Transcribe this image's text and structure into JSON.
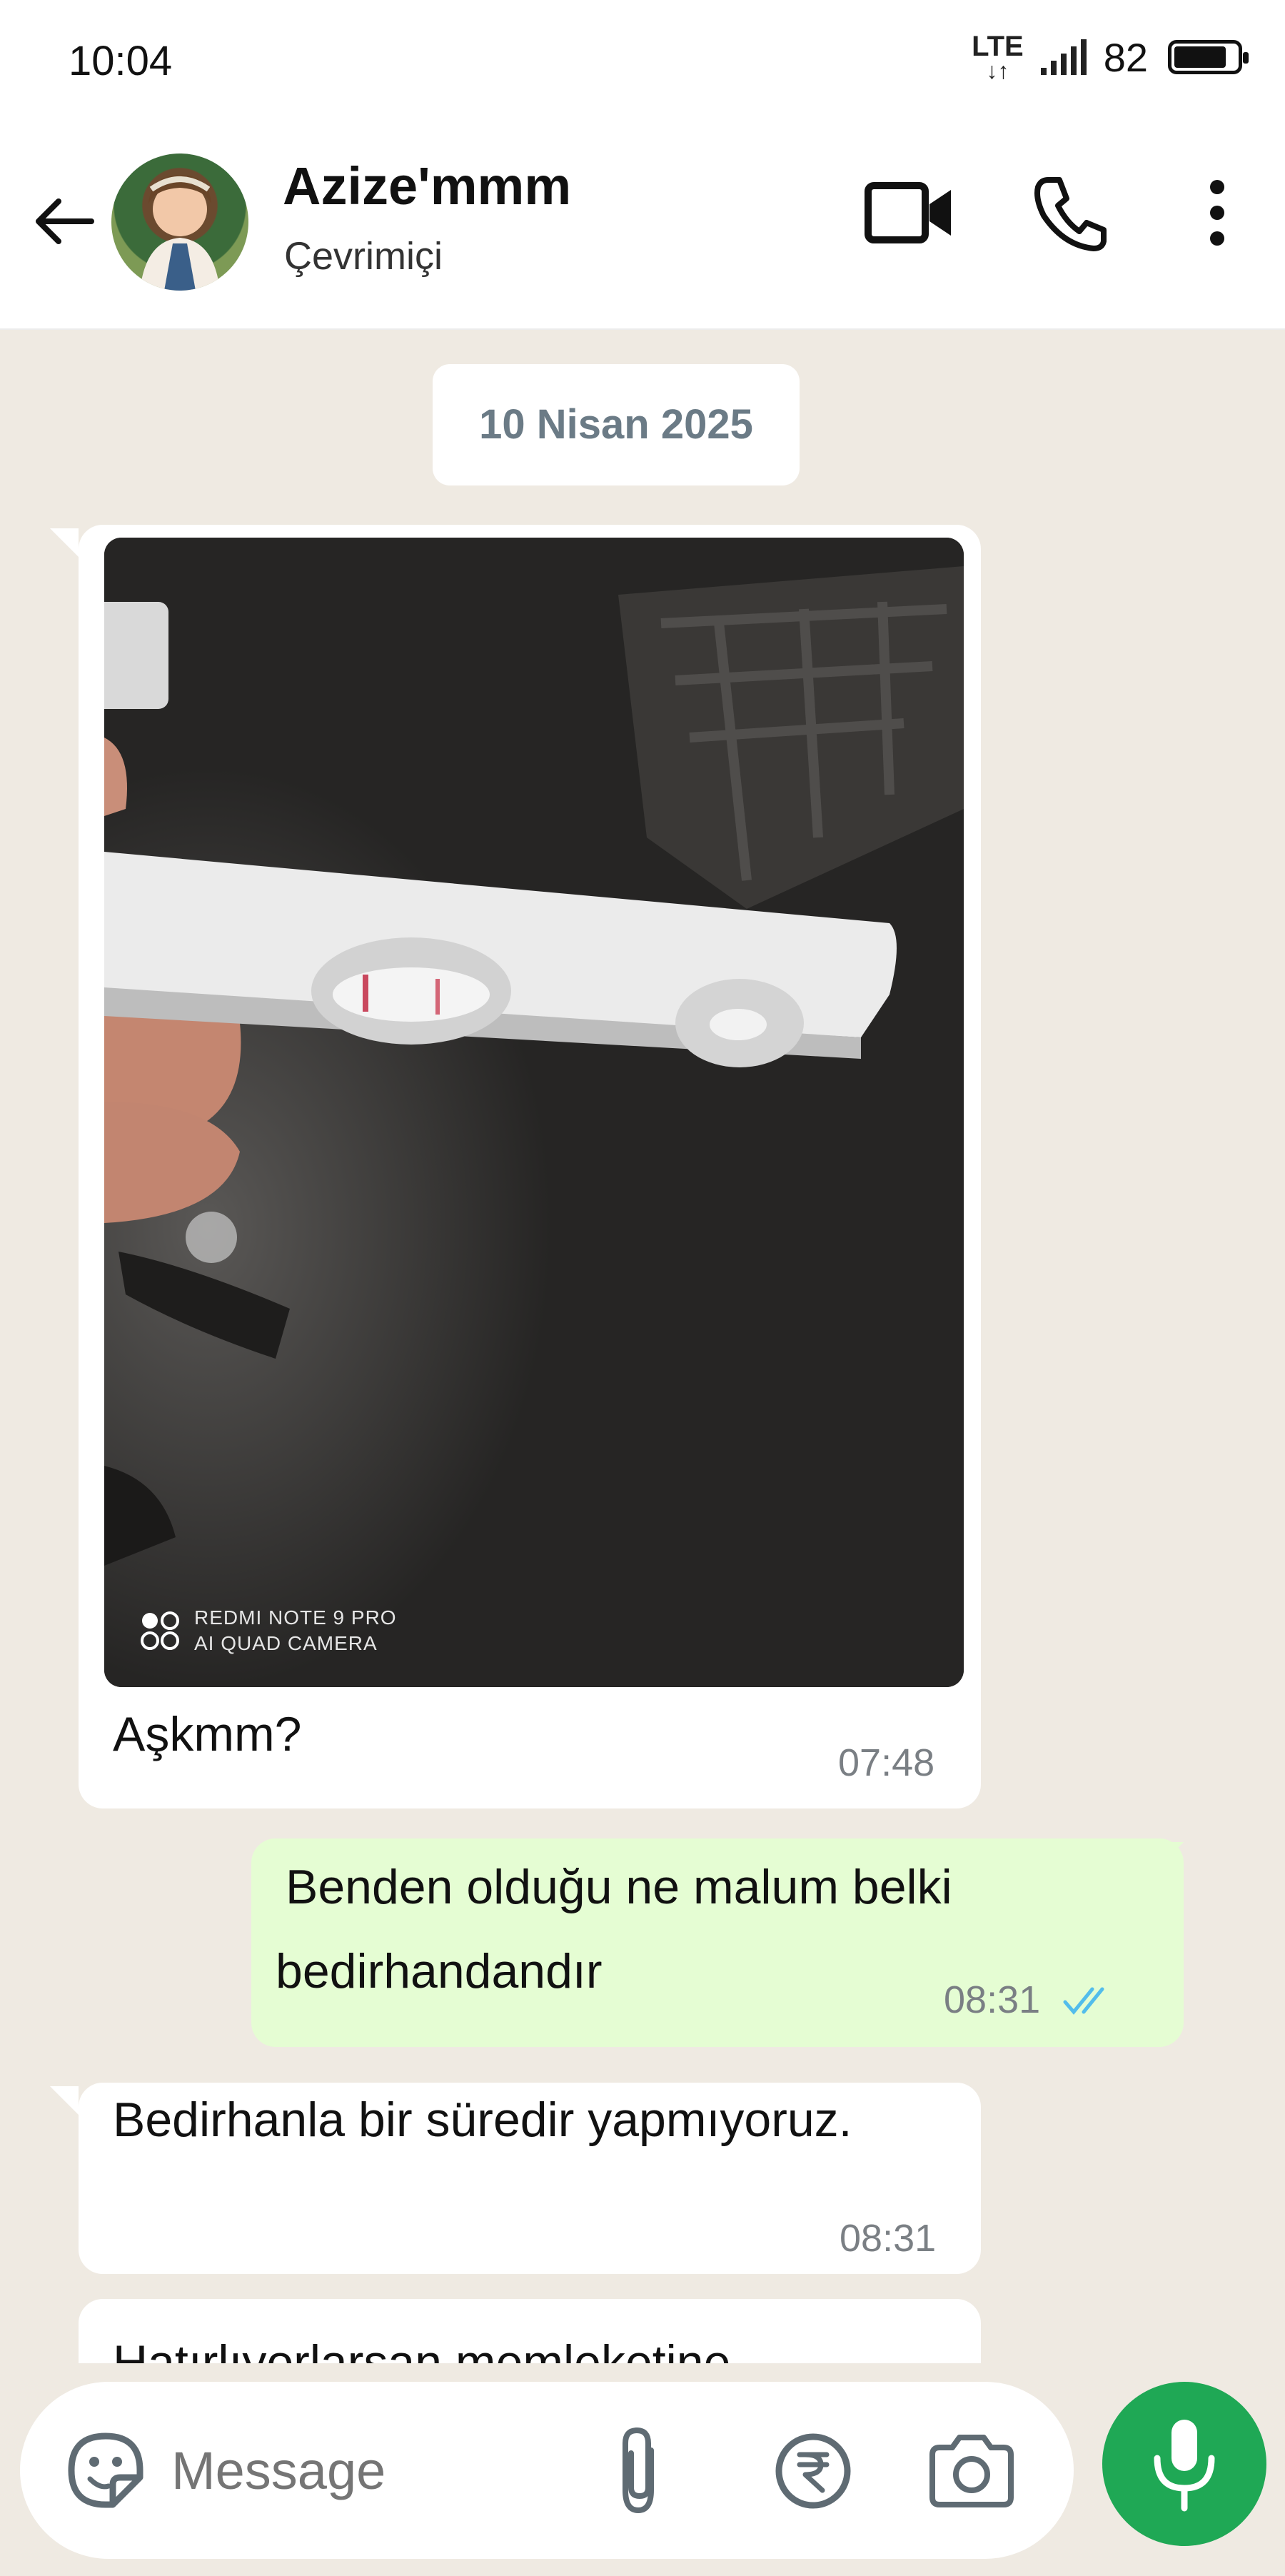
{
  "status_bar": {
    "time": "10:04",
    "network": "LTE",
    "battery_percent": "82"
  },
  "header": {
    "contact_name": "Azize'mmm",
    "contact_status": "Çevrimiçi"
  },
  "chat": {
    "date_chip": "10 Nisan 2025",
    "messages": [
      {
        "direction": "in",
        "type": "image",
        "watermark_line1": "REDMI NOTE 9 PRO",
        "watermark_line2": "AI QUAD CAMERA",
        "caption": "Aşkmm?",
        "time": "07:48"
      },
      {
        "direction": "out",
        "line1": "Benden olduğu ne malum belki",
        "line2": "bedirhandandır",
        "time": "08:31",
        "status": "read"
      },
      {
        "direction": "in",
        "text": "Bedirhanla bir süredir yapmıyoruz.",
        "time": "08:31"
      },
      {
        "direction": "in",
        "text": "Hatırlıyorlarsan memleketine"
      }
    ]
  },
  "input": {
    "placeholder": "Message"
  },
  "colors": {
    "accent_green": "#1fa855",
    "outgoing_bubble": "#e5fdd3",
    "read_ticks": "#53bdeb",
    "chat_background": "#efeae2"
  }
}
